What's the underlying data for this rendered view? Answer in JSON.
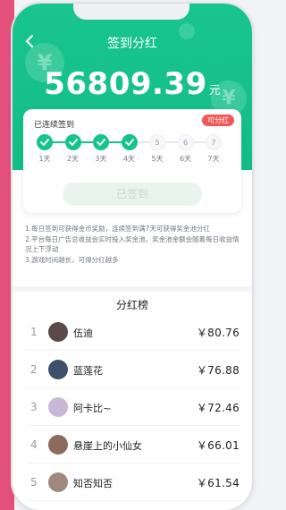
{
  "page": {
    "title": "签到分红",
    "back_icon": "chevron-left-icon"
  },
  "balance": {
    "amount": "56809.39",
    "unit": "元"
  },
  "signin": {
    "label": "已连续签到",
    "bonus_tag": "可分红",
    "days": [
      {
        "num": "",
        "label": "1天",
        "checked": true
      },
      {
        "num": "",
        "label": "2天",
        "checked": true
      },
      {
        "num": "",
        "label": "3天",
        "checked": true
      },
      {
        "num": "",
        "label": "4天",
        "checked": true
      },
      {
        "num": "5",
        "label": "5天",
        "checked": false
      },
      {
        "num": "6",
        "label": "6天",
        "checked": false
      },
      {
        "num": "7",
        "label": "7天",
        "checked": false
      }
    ],
    "button_label": "已签到"
  },
  "rules": [
    "1.每日签到可获得金币奖励，连续签到满7天可获得奖金池分红",
    "2.平台每日广告总收益会实时投入奖金池，奖金池金额会随着每日收益情况上下浮动",
    "3.游戏时间越长，可得分红越多"
  ],
  "ranking": {
    "title": "分红榜",
    "items": [
      {
        "rank": "1",
        "name": "伍迪",
        "amount": "￥80.76",
        "avatar_color": "#5b4a48"
      },
      {
        "rank": "2",
        "name": "蓝莲花",
        "amount": "￥76.88",
        "avatar_color": "#3d4f6b"
      },
      {
        "rank": "3",
        "name": "阿卡比~",
        "amount": "￥72.46",
        "avatar_color": "#c9b7d6"
      },
      {
        "rank": "4",
        "name": "悬崖上的小仙女",
        "amount": "￥66.01",
        "avatar_color": "#8a6b5c"
      },
      {
        "rank": "5",
        "name": "知否知否",
        "amount": "￥61.54",
        "avatar_color": "#a1887f"
      }
    ]
  },
  "colors": {
    "brand": "#16c487",
    "tag": "#f25757",
    "side_stripe": "#e4507c"
  }
}
